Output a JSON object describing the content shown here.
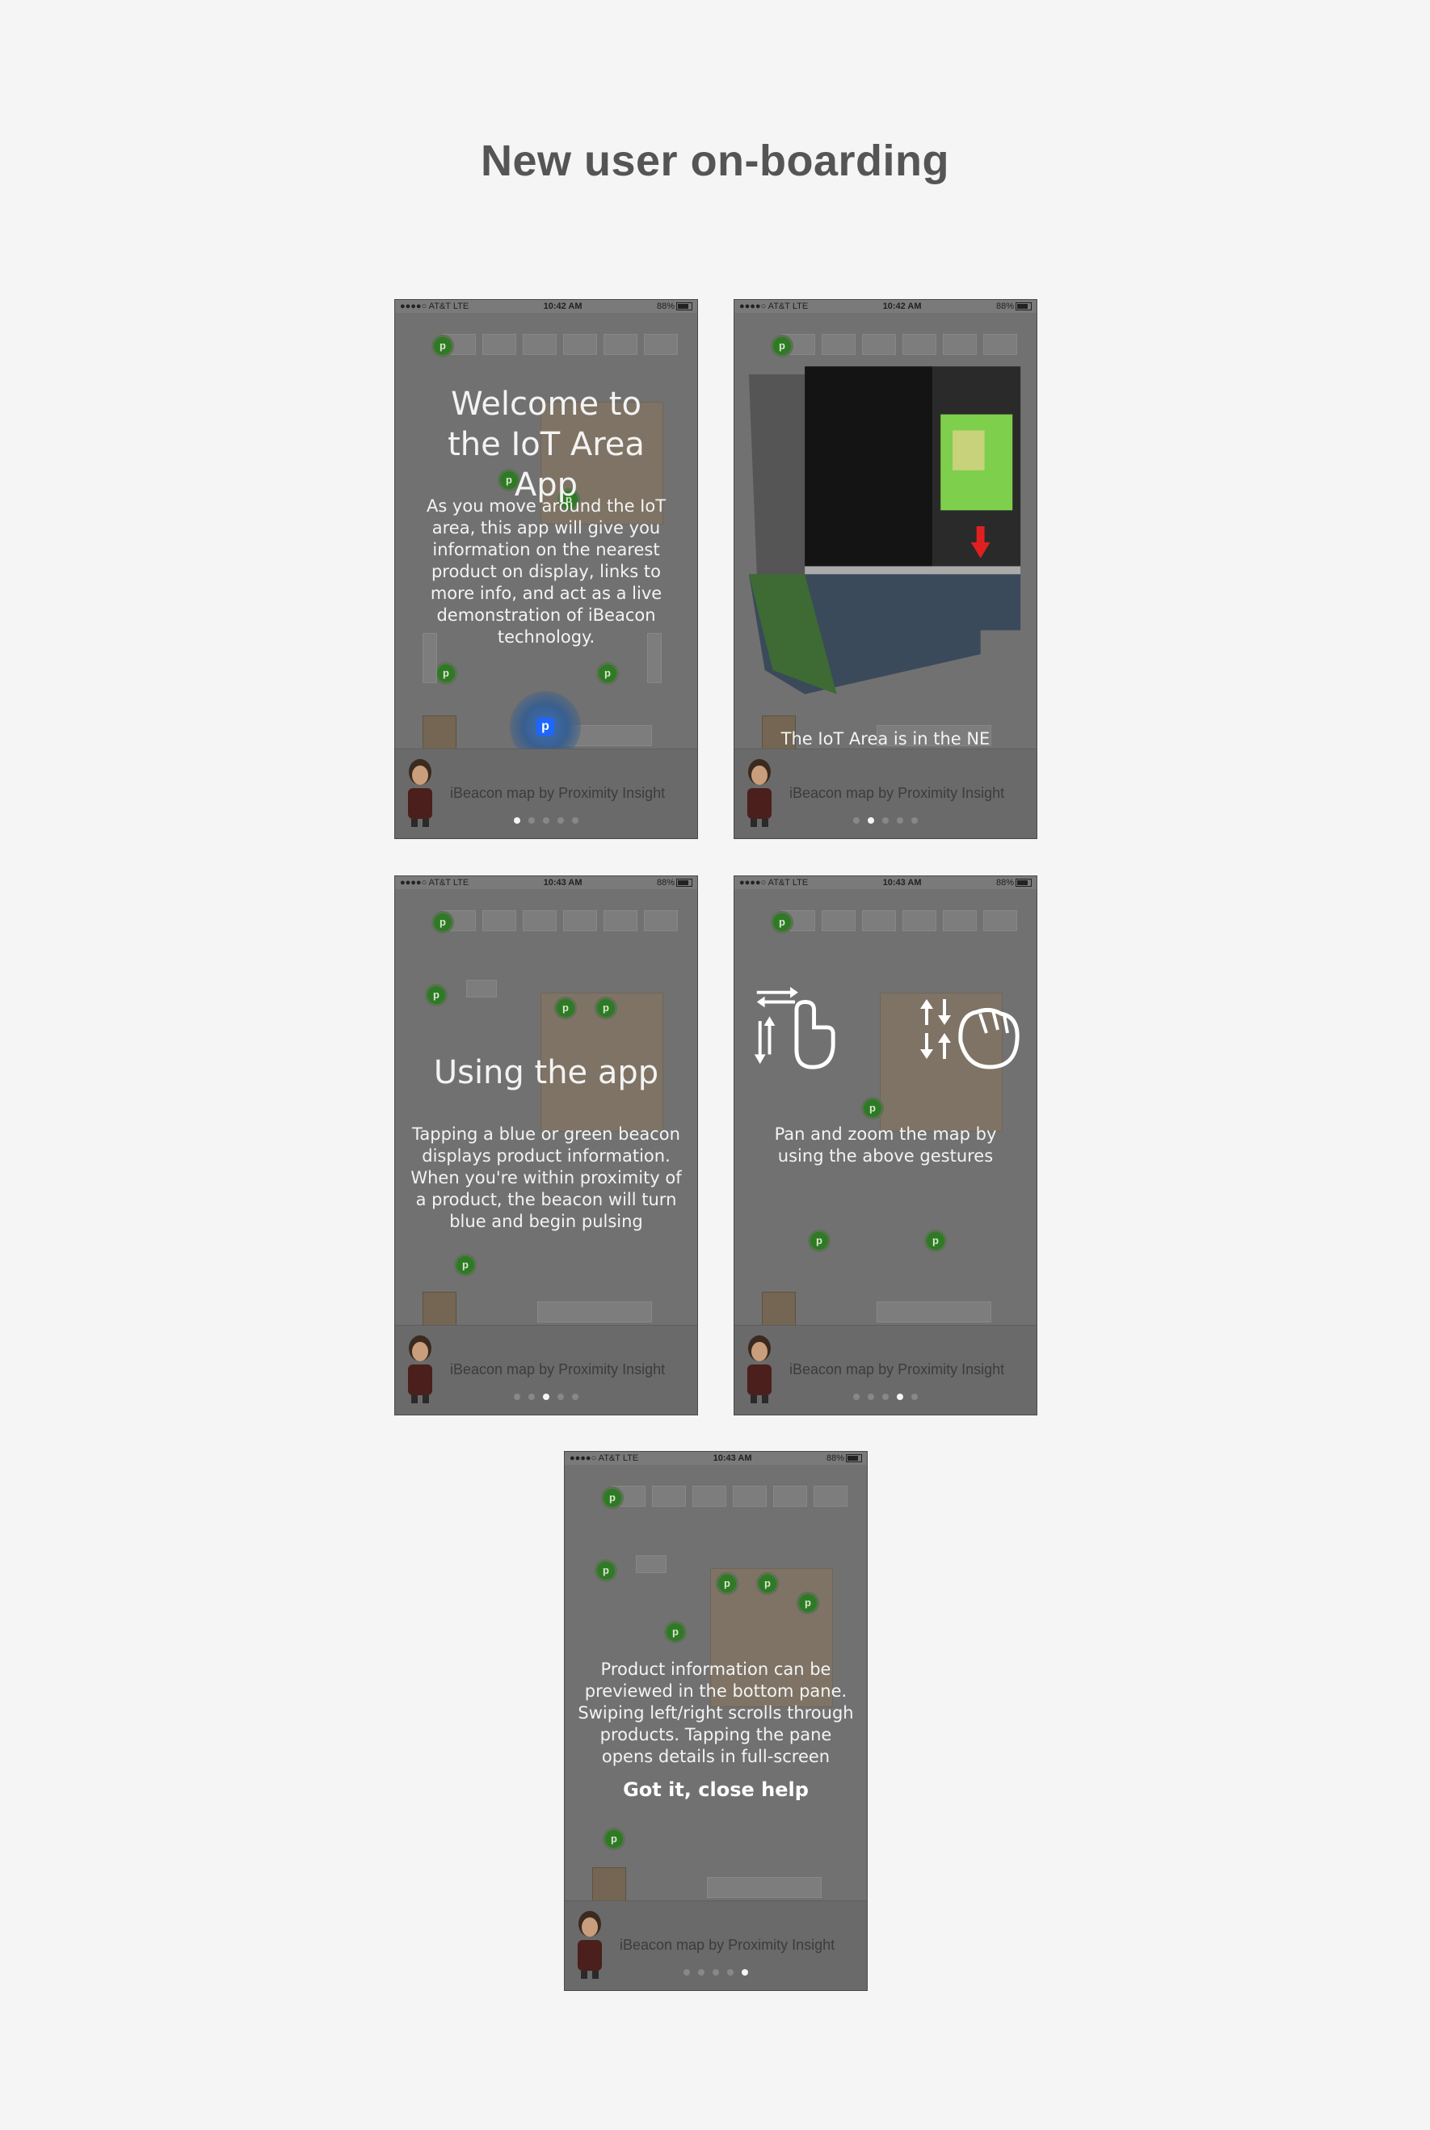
{
  "page": {
    "title": "New user on-boarding"
  },
  "screens": [
    {
      "status": {
        "carrier": "●●●●○ AT&T LTE",
        "time": "10:42 AM",
        "battery": "88%"
      },
      "headline": "Welcome to the IoT Area App",
      "body": "As you move around the IoT area, this app will give you information on the nearest product on display, links to more info, and act as a live demonstration of iBeacon technology.",
      "footer": "iBeacon map by Proximity Insight",
      "active_dot": 0
    },
    {
      "status": {
        "carrier": "●●●●○ AT&T LTE",
        "time": "10:42 AM",
        "battery": "88%"
      },
      "body": "The IoT Area is in the NE quadrant of the venue, beside the 'App Cloud Area'",
      "footer": "iBeacon map by Proximity Insight",
      "active_dot": 1
    },
    {
      "status": {
        "carrier": "●●●●○ AT&T LTE",
        "time": "10:43 AM",
        "battery": "88%"
      },
      "headline": "Using the app",
      "body": "Tapping a blue or green beacon displays product information. When you're within proximity of a product, the beacon will turn blue and begin pulsing",
      "footer": "iBeacon map by Proximity Insight",
      "active_dot": 2
    },
    {
      "status": {
        "carrier": "●●●●○ AT&T LTE",
        "time": "10:43 AM",
        "battery": "88%"
      },
      "body": "Pan and zoom the map by using the above gestures",
      "footer": "iBeacon map by Proximity Insight",
      "active_dot": 3
    },
    {
      "status": {
        "carrier": "●●●●○ AT&T LTE",
        "time": "10:43 AM",
        "battery": "88%"
      },
      "body": "Product information can be previewed in the bottom pane. Swiping left/right scrolls through products. Tapping the pane opens details in full-screen",
      "close_label": "Got it, close help",
      "footer": "iBeacon map by Proximity Insight",
      "active_dot": 4
    }
  ],
  "beacon_glyph": "p",
  "colors": {
    "background": "#f5f5f5",
    "beacon_green": "#2f7a24",
    "beacon_blue": "#1e66ff",
    "arrow_red": "#e02020"
  }
}
